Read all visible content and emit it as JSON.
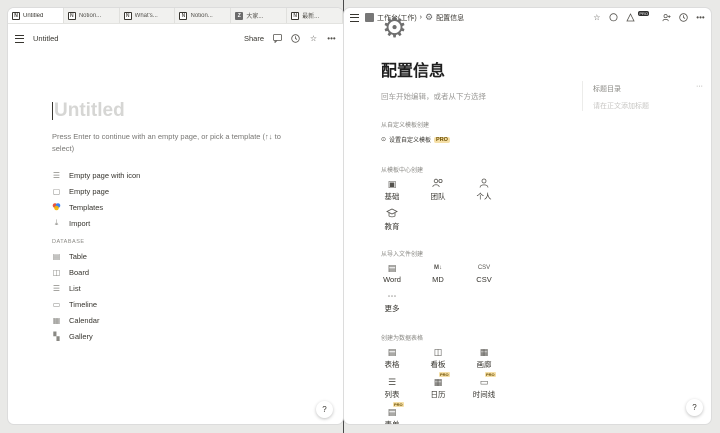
{
  "left": {
    "tabs": [
      {
        "icon": "notion-icon",
        "label": "Untitled",
        "active": true
      },
      {
        "icon": "notion-icon",
        "label": "Notion..."
      },
      {
        "icon": "notion-icon",
        "label": "What's..."
      },
      {
        "icon": "notion-icon",
        "label": "Notion..."
      },
      {
        "icon": "z-app-icon",
        "label": "大家..."
      },
      {
        "icon": "notion-icon",
        "label": "最新..."
      }
    ],
    "topbar": {
      "page_title": "Untitled",
      "share_label": "Share"
    },
    "page": {
      "title_placeholder": "Untitled",
      "hint": "Press Enter to continue with an empty page, or pick a template (↑↓ to select)",
      "options": [
        {
          "icon": "document-lines-icon",
          "label": "Empty page with icon"
        },
        {
          "icon": "document-icon",
          "label": "Empty page"
        },
        {
          "icon": "templates-icon",
          "label": "Templates"
        },
        {
          "icon": "import-icon",
          "label": "Import"
        }
      ],
      "database_label": "DATABASE",
      "database_options": [
        {
          "icon": "table-icon",
          "label": "Table"
        },
        {
          "icon": "board-icon",
          "label": "Board"
        },
        {
          "icon": "list-icon",
          "label": "List"
        },
        {
          "icon": "timeline-icon",
          "label": "Timeline"
        },
        {
          "icon": "calendar-icon",
          "label": "Calendar"
        },
        {
          "icon": "gallery-icon",
          "label": "Gallery"
        }
      ]
    },
    "help_label": "?"
  },
  "right": {
    "breadcrumb": {
      "workspace": "工作台(工作)",
      "separator": "›",
      "page": "配置信息"
    },
    "title": "配置信息",
    "hint": "回车开始编辑，或者从下方选择",
    "toc": {
      "title": "标题目录",
      "more": "···",
      "empty": "请在正文添加标题"
    },
    "sections": {
      "custom": {
        "label": "从自定义模板创建",
        "item": "设置自定义模板",
        "pro": "PRO"
      },
      "template_center": {
        "label": "从模板中心创建",
        "items": [
          {
            "icon": "basic-icon",
            "label": "基础"
          },
          {
            "icon": "team-icon",
            "label": "团队"
          },
          {
            "icon": "person-icon",
            "label": "个人"
          },
          {
            "icon": "education-icon",
            "label": "教育"
          }
        ]
      },
      "import_file": {
        "label": "从导入文件创建",
        "items": [
          {
            "icon": "word-icon",
            "label": "Word"
          },
          {
            "icon": "markdown-icon",
            "label": "MD",
            "glyph": "M↓"
          },
          {
            "icon": "csv-icon",
            "label": "CSV",
            "glyph": "CSV"
          },
          {
            "icon": "more-icon",
            "label": "更多"
          }
        ]
      },
      "database": {
        "label": "创建为数据表格",
        "items": [
          {
            "icon": "table-icon",
            "label": "表格"
          },
          {
            "icon": "board-icon",
            "label": "看板"
          },
          {
            "icon": "gallery-icon",
            "label": "画廊"
          },
          {
            "icon": "list-icon",
            "label": "列表"
          },
          {
            "icon": "calendar-icon",
            "label": "日历",
            "pro": "PRO"
          },
          {
            "icon": "timeline-icon",
            "label": "时间线",
            "pro": "PRO"
          },
          {
            "icon": "form-icon",
            "label": "表单",
            "pro": "PRO"
          }
        ]
      }
    },
    "topbar_pro": "PRO",
    "help_label": "?"
  }
}
